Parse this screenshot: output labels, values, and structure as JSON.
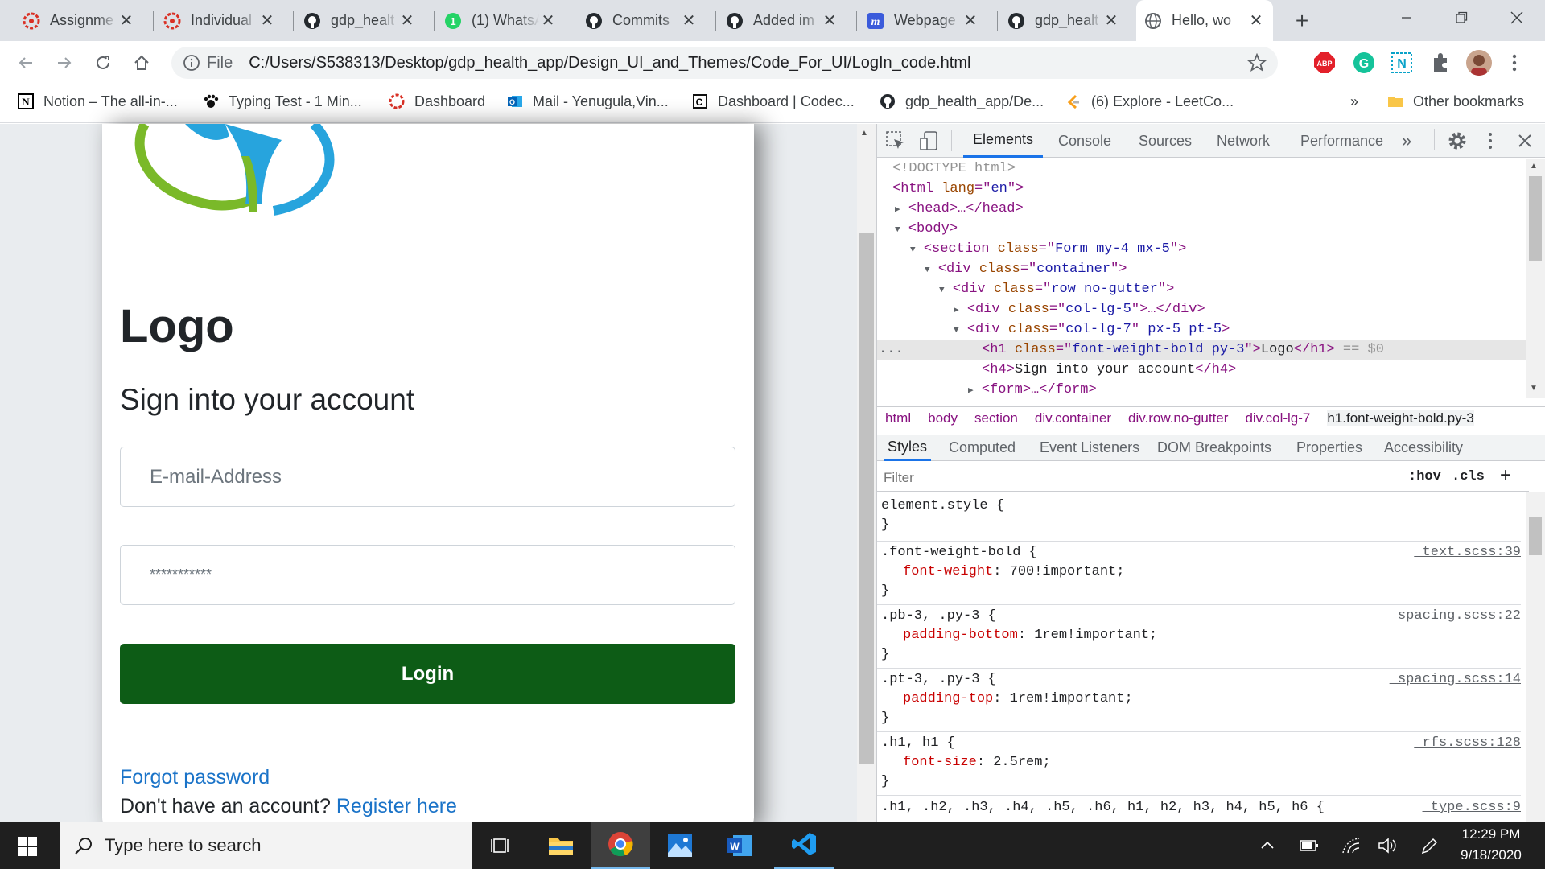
{
  "tabs": [
    {
      "title": "Assignme",
      "icon": "asana-like-icon"
    },
    {
      "title": "Individual",
      "icon": "asana-like-icon"
    },
    {
      "title": "gdp_healt",
      "icon": "github-icon"
    },
    {
      "title": "(1) WhatsA",
      "icon": "whatsapp-badge-icon"
    },
    {
      "title": "Commits",
      "icon": "github-icon"
    },
    {
      "title": "Added im",
      "icon": "github-icon"
    },
    {
      "title": "Webpage",
      "icon": "m-logo-icon"
    },
    {
      "title": "gdp_healt",
      "icon": "github-icon"
    },
    {
      "title": "Hello, wo",
      "icon": "globe-icon",
      "active": true
    }
  ],
  "address": {
    "scheme_label": "File",
    "url": "C:/Users/S538313/Desktop/gdp_health_app/Design_UI_and_Themes/Code_For_UI/LogIn_code.html"
  },
  "extensions": {
    "abp_label": "ABP",
    "grammarly_label": "G",
    "n_label": "N"
  },
  "bookmarks": [
    {
      "label": "Notion – The all-in-...",
      "icon": "notion-icon"
    },
    {
      "label": "Typing Test - 1 Min...",
      "icon": "paw-icon"
    },
    {
      "label": "Dashboard",
      "icon": "asana-like-icon"
    },
    {
      "label": "Mail - Yenugula,Vin...",
      "icon": "outlook-icon"
    },
    {
      "label": "Dashboard | Codec...",
      "icon": "codecademy-icon"
    },
    {
      "label": "gdp_health_app/De...",
      "icon": "github-icon"
    },
    {
      "label": "(6) Explore - LeetCo...",
      "icon": "leetcode-icon"
    }
  ],
  "bookmarks_more": "»",
  "other_bookmarks": "Other bookmarks",
  "login_page": {
    "heading": "Logo",
    "subheading": "Sign into your account",
    "email_placeholder": "E-mail-Address",
    "password_placeholder": "***********",
    "login_button": "Login",
    "forgot_password": "Forgot password",
    "no_account_text": "Don't have an account?",
    "register_link": "Register here"
  },
  "devtools": {
    "tabs": [
      "Elements",
      "Console",
      "Sources",
      "Network",
      "Performance"
    ],
    "more": "»",
    "dom": {
      "l1": "<!DOCTYPE html>",
      "l2a": "<html ",
      "l2b": "lang",
      "l2c": "=\"",
      "l2d": "en",
      "l2e": "\">",
      "l3": "<head>…</head>",
      "l4": "<body>",
      "l5a": "<section ",
      "l5b": "class",
      "l5c": "Form my-4 mx-5",
      "l6a": "<div ",
      "l6b": "class",
      "l6c": "container",
      "l7a": "<div ",
      "l7b": "class",
      "l7c": "row no-gutter",
      "l8a": "<div ",
      "l8b": "class",
      "l8c": "col-lg-5",
      "l8d": ">…</div>",
      "l9a": "<div ",
      "l9b": "class",
      "l9c": "col-lg-7",
      "l9d": "px-5 pt-5",
      "l10a": "<h1 ",
      "l10b": "class",
      "l10c": "font-weight-bold py-3",
      "l10d": "Logo",
      "l10e": "</h1>",
      "l10f": " == $0",
      "l11a": "<h4>",
      "l11b": "Sign into your account",
      "l11c": "</h4>",
      "l12": "<form>…</form>",
      "ellipsis": "..."
    },
    "breadcrumbs": [
      "html",
      "body",
      "section",
      "div.container",
      "div.row.no-gutter",
      "div.col-lg-7",
      "h1.font-weight-bold.py-3"
    ],
    "subtabs": [
      "Styles",
      "Computed",
      "Event Listeners",
      "DOM Breakpoints",
      "Properties",
      "Accessibility"
    ],
    "filter_placeholder": "Filter",
    "hov": ":hov",
    "cls": ".cls",
    "add": "+",
    "rules": {
      "r0sel": "element.style {",
      "close": "}",
      "r1sel": ".font-weight-bold {",
      "r1prop": "font-weight",
      "r1val": "700!important;",
      "r1src": "_text.scss:39",
      "r2sel": ".pb-3, .py-3 {",
      "r2prop": "padding-bottom",
      "r2val": "1rem!important;",
      "r2src": "_spacing.scss:22",
      "r3sel": ".pt-3, .py-3 {",
      "r3prop": "padding-top",
      "r3val": "1rem!important;",
      "r3src": "_spacing.scss:14",
      "r4sel": ".h1, h1 {",
      "r4prop": "font-size",
      "r4val": "2.5rem;",
      "r4src": "_rfs.scss:128",
      "r5sel": ".h1, .h2, .h3, .h4, .h5, .h6, h1, h2, h3, h4, h5, h6 {",
      "r5src": "_type.scss:9"
    }
  },
  "taskbar": {
    "search_placeholder": "Type here to search",
    "time": "12:29 PM",
    "date": "9/18/2020"
  },
  "colors": {
    "login_green": "#0d5c16",
    "link_blue": "#1a73c8",
    "devtools_accent": "#1a73e8",
    "logo_blue": "#27a4dd",
    "logo_green": "#7ab929"
  }
}
